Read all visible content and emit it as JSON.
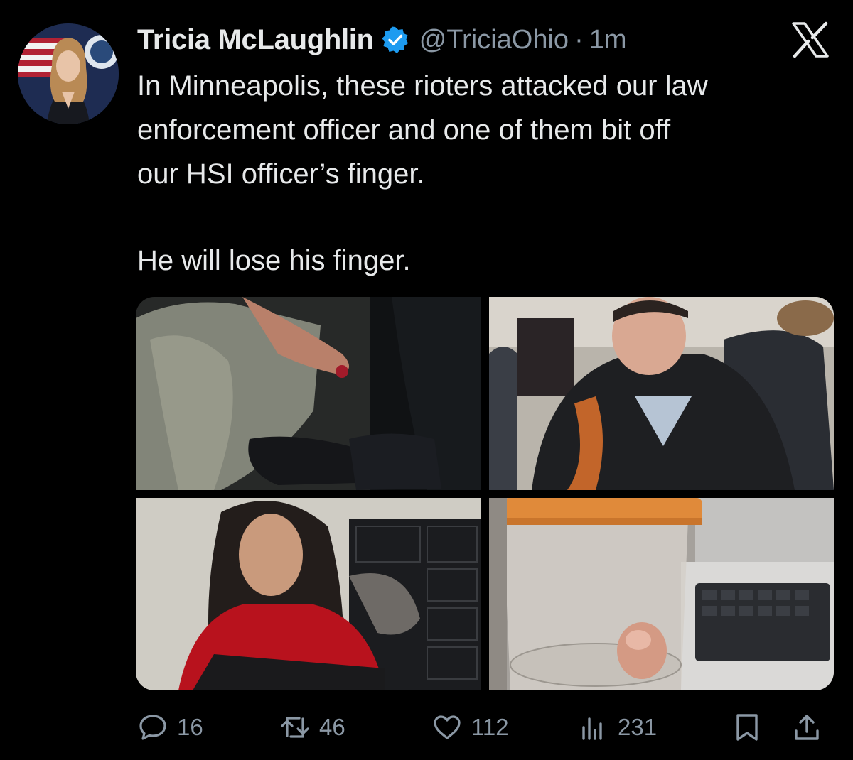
{
  "tweet": {
    "author": {
      "name": "Tricia McLaughlin",
      "handle": "@TriciaOhio",
      "verified": true
    },
    "separator": "·",
    "time": "1m",
    "text_lines": [
      "In Minneapolis, these rioters attacked our law",
      "enforcement officer and one of them bit off",
      "our HSI officer’s finger."
    ],
    "text_line_2": "He will lose his finger.",
    "media": [
      {
        "icon": "photo-gloved-hand-injured-finger"
      },
      {
        "icon": "photo-person-in-jacket"
      },
      {
        "icon": "photo-person-red-jacket"
      },
      {
        "icon": "photo-specimen-container"
      }
    ],
    "metrics": {
      "replies": "16",
      "reposts": "46",
      "likes": "112",
      "views": "231"
    }
  },
  "colors": {
    "background": "#000000",
    "text": "#e7e9ea",
    "secondary": "#8b98a5",
    "verified": "#1d9bf0"
  }
}
